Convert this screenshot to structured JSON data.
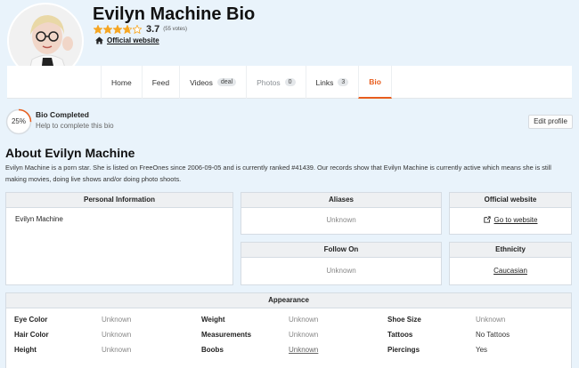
{
  "profile": {
    "name": "Evilyn Machine Bio",
    "rating": "3.7",
    "rating_stars": 3.7,
    "votes": "(55 votes)",
    "website_label": "Official website"
  },
  "tabs": [
    {
      "label": "Home",
      "badge": ""
    },
    {
      "label": "Feed",
      "badge": ""
    },
    {
      "label": "Videos",
      "badge": "deal"
    },
    {
      "label": "Photos",
      "badge": "0"
    },
    {
      "label": "Links",
      "badge": "3"
    },
    {
      "label": "Bio",
      "badge": ""
    }
  ],
  "bio_status": {
    "percent": "25%",
    "progress": 0.25,
    "title": "Bio Completed",
    "subtitle": "Help to complete this bio",
    "edit_label": "Edit profile"
  },
  "about": {
    "title": "About Evilyn Machine",
    "text": "Evilyn Machine is a porn star. She is listed on FreeOnes since 2006-09-05 and is currently ranked #41439. Our records show that Evilyn Machine is currently active which means she is still making movies, doing live shows and/or doing photo shoots."
  },
  "cards": {
    "personal": {
      "title": "Personal Information",
      "value": "Evilyn Machine"
    },
    "aliases": {
      "title": "Aliases",
      "value": "Unknown"
    },
    "official": {
      "title": "Official website",
      "link": "Go to website"
    },
    "follow": {
      "title": "Follow On",
      "value": "Unknown"
    },
    "ethnicity": {
      "title": "Ethnicity",
      "value": "Caucasian"
    }
  },
  "appearance": {
    "title": "Appearance",
    "rows": [
      [
        {
          "label": "Eye Color",
          "value": "Unknown"
        },
        {
          "label": "Weight",
          "value": "Unknown"
        },
        {
          "label": "Shoe Size",
          "value": "Unknown"
        }
      ],
      [
        {
          "label": "Hair Color",
          "value": "Unknown"
        },
        {
          "label": "Measurements",
          "value": "Unknown"
        },
        {
          "label": "Tattoos",
          "value": "No Tattoos"
        }
      ],
      [
        {
          "label": "Height",
          "value": "Unknown"
        },
        {
          "label": "Boobs",
          "value": "Unknown"
        },
        {
          "label": "Piercings",
          "value": "Yes"
        }
      ]
    ]
  },
  "colors": {
    "accent": "#e85d1d",
    "star": "#f5a623",
    "page_bg": "#e9f3fb"
  }
}
